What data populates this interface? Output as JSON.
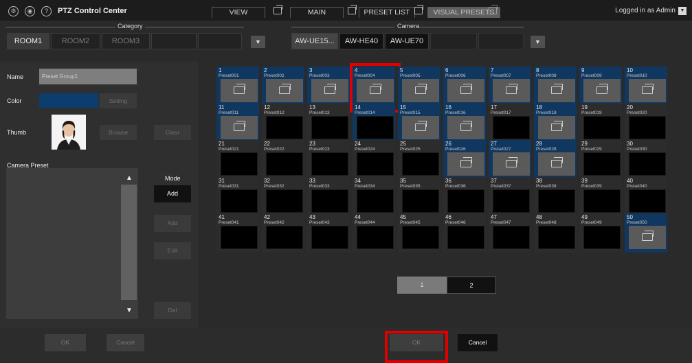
{
  "app": {
    "title": "PTZ Control Center",
    "logged_in": "Logged in as Admin",
    "top_tabs": [
      {
        "label": "VIEW",
        "active": false
      },
      {
        "label": "MAIN",
        "active": false
      },
      {
        "label": "PRESET LIST",
        "active": false
      },
      {
        "label": "VISUAL PRESETS",
        "active": true
      }
    ],
    "icons": [
      "gear-icon",
      "camera-icon",
      "help-icon"
    ]
  },
  "category": {
    "label": "Category",
    "items": [
      {
        "label": "ROOM1",
        "active": true
      },
      {
        "label": "ROOM2",
        "active": false
      },
      {
        "label": "ROOM3",
        "active": false
      }
    ]
  },
  "camera": {
    "label": "Camera",
    "items": [
      {
        "label": "AW-UE15...",
        "active": true
      },
      {
        "label": "AW-HE40",
        "active": false
      },
      {
        "label": "AW-UE70",
        "active": false
      }
    ]
  },
  "left": {
    "name_label": "Name",
    "name_value": "Preset Group1",
    "color_label": "Color",
    "color_value": "#0b3d6e",
    "setting_button": "Setting",
    "thumb_label": "Thumb",
    "browse_button": "Browse",
    "clear_button": "Clear",
    "camera_preset_label": "Camera Preset",
    "mode_label": "Mode",
    "mode_add": "Add",
    "add_button": "Add",
    "edit_button": "Edit",
    "del_button": "Del",
    "up_arrow": "▲",
    "down_arrow": "▼"
  },
  "grid": {
    "filled": [
      1,
      2,
      3,
      4,
      5,
      6,
      7,
      8,
      9,
      10,
      11,
      15,
      16,
      18,
      26,
      27,
      28,
      50
    ],
    "blue": [
      1,
      2,
      3,
      4,
      5,
      6,
      7,
      8,
      9,
      10,
      11,
      14,
      15,
      16,
      18,
      26,
      27,
      28,
      50
    ],
    "highlighted": [
      4
    ],
    "presets": [
      {
        "num": "1",
        "name": "Preset001"
      },
      {
        "num": "2",
        "name": "Preset002"
      },
      {
        "num": "3",
        "name": "Preset003"
      },
      {
        "num": "4",
        "name": "Preset004"
      },
      {
        "num": "5",
        "name": "Preset005"
      },
      {
        "num": "6",
        "name": "Preset006"
      },
      {
        "num": "7",
        "name": "Preset007"
      },
      {
        "num": "8",
        "name": "Preset008"
      },
      {
        "num": "9",
        "name": "Preset009"
      },
      {
        "num": "10",
        "name": "Preset010"
      },
      {
        "num": "11",
        "name": "Preset011"
      },
      {
        "num": "12",
        "name": "Preset012"
      },
      {
        "num": "13",
        "name": "Preset013"
      },
      {
        "num": "14",
        "name": "Preset014"
      },
      {
        "num": "15",
        "name": "Preset015"
      },
      {
        "num": "16",
        "name": "Preset016"
      },
      {
        "num": "17",
        "name": "Preset017"
      },
      {
        "num": "18",
        "name": "Preset018"
      },
      {
        "num": "19",
        "name": "Preset019"
      },
      {
        "num": "20",
        "name": "Preset020"
      },
      {
        "num": "21",
        "name": "Preset021"
      },
      {
        "num": "22",
        "name": "Preset022"
      },
      {
        "num": "23",
        "name": "Preset023"
      },
      {
        "num": "24",
        "name": "Preset024"
      },
      {
        "num": "25",
        "name": "Preset025"
      },
      {
        "num": "26",
        "name": "Preset026"
      },
      {
        "num": "27",
        "name": "Preset027"
      },
      {
        "num": "28",
        "name": "Preset028"
      },
      {
        "num": "29",
        "name": "Preset029"
      },
      {
        "num": "30",
        "name": "Preset030"
      },
      {
        "num": "31",
        "name": "Preset031"
      },
      {
        "num": "32",
        "name": "Preset032"
      },
      {
        "num": "33",
        "name": "Preset033"
      },
      {
        "num": "34",
        "name": "Preset034"
      },
      {
        "num": "35",
        "name": "Preset035"
      },
      {
        "num": "36",
        "name": "Preset036"
      },
      {
        "num": "37",
        "name": "Preset037"
      },
      {
        "num": "38",
        "name": "Preset038"
      },
      {
        "num": "39",
        "name": "Preset039"
      },
      {
        "num": "40",
        "name": "Preset040"
      },
      {
        "num": "41",
        "name": "Preset041"
      },
      {
        "num": "42",
        "name": "Preset042"
      },
      {
        "num": "43",
        "name": "Preset043"
      },
      {
        "num": "44",
        "name": "Preset044"
      },
      {
        "num": "45",
        "name": "Preset045"
      },
      {
        "num": "46",
        "name": "Preset046"
      },
      {
        "num": "47",
        "name": "Preset047"
      },
      {
        "num": "48",
        "name": "Preset048"
      },
      {
        "num": "49",
        "name": "Preset049"
      },
      {
        "num": "50",
        "name": "Preset050"
      }
    ]
  },
  "pagination": {
    "pages": [
      "1",
      "2"
    ],
    "current": "1"
  },
  "bottom": {
    "left_ok": "OK",
    "left_cancel": "Cancel",
    "ok": "OK",
    "cancel": "Cancel"
  },
  "colors": {
    "accent_blue": "#10375f",
    "highlight_red": "#e00000"
  }
}
